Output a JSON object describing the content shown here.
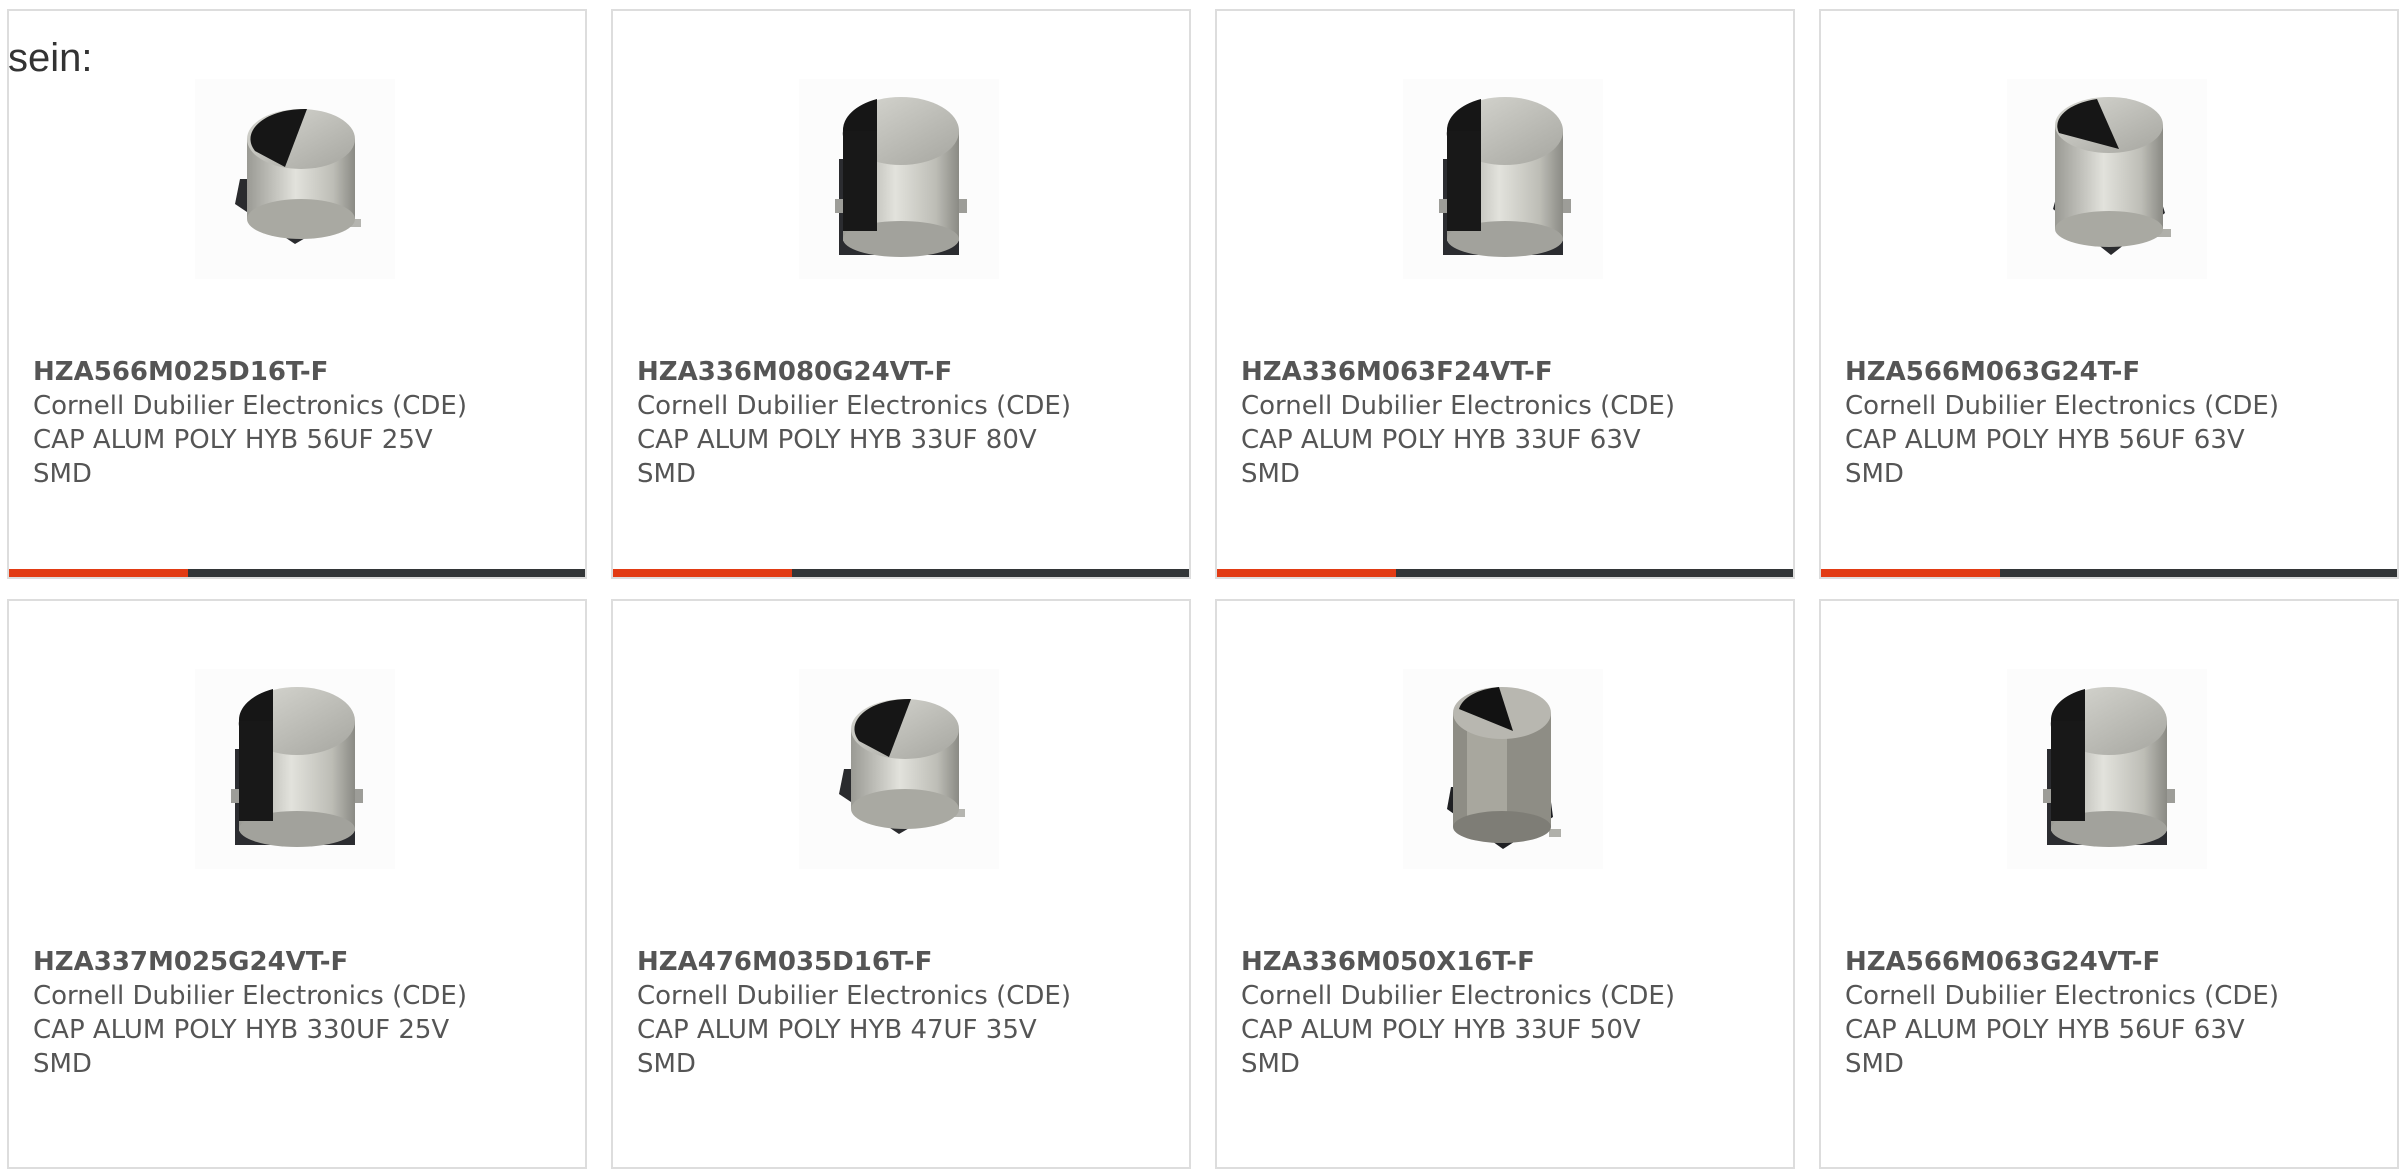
{
  "intro_text": "sein:",
  "colors": {
    "accent": "#e23b14",
    "bar_track": "#333638",
    "card_border": "#dddddd",
    "text": "#555555"
  },
  "products": [
    {
      "part_number": "HZA566M025D16T-F",
      "manufacturer": "Cornell Dubilier Electronics (CDE)",
      "description": "CAP ALUM POLY HYB 56UF 25V SMD",
      "image": "wide-capacitor-image",
      "progress_fraction": 0.31
    },
    {
      "part_number": "HZA336M080G24VT-F",
      "manufacturer": "Cornell Dubilier Electronics (CDE)",
      "description": "CAP ALUM POLY HYB 33UF 80V SMD",
      "image": "tall-capacitor-image",
      "progress_fraction": 0.31
    },
    {
      "part_number": "HZA336M063F24VT-F",
      "manufacturer": "Cornell Dubilier Electronics (CDE)",
      "description": "CAP ALUM POLY HYB 33UF 63V SMD",
      "image": "tall-capacitor-image",
      "progress_fraction": 0.31
    },
    {
      "part_number": "HZA566M063G24T-F",
      "manufacturer": "Cornell Dubilier Electronics (CDE)",
      "description": "CAP ALUM POLY HYB 56UF 63V SMD",
      "image": "tall-capacitor-image",
      "progress_fraction": 0.31
    },
    {
      "part_number": "HZA337M025G24VT-F",
      "manufacturer": "Cornell Dubilier Electronics (CDE)",
      "description": "CAP ALUM POLY HYB 330UF 25V SMD",
      "image": "tall-capacitor-image"
    },
    {
      "part_number": "HZA476M035D16T-F",
      "manufacturer": "Cornell Dubilier Electronics (CDE)",
      "description": "CAP ALUM POLY HYB 47UF 35V SMD",
      "image": "wide-capacitor-image"
    },
    {
      "part_number": "HZA336M050X16T-F",
      "manufacturer": "Cornell Dubilier Electronics (CDE)",
      "description": "CAP ALUM POLY HYB 33UF 50V SMD",
      "image": "tall-capacitor-image"
    },
    {
      "part_number": "HZA566M063G24VT-F",
      "manufacturer": "Cornell Dubilier Electronics (CDE)",
      "description": "CAP ALUM POLY HYB 56UF 63V SMD",
      "image": "tall-capacitor-image"
    }
  ]
}
